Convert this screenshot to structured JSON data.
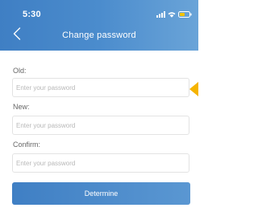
{
  "status_bar": {
    "time": "5:30",
    "icons": [
      "signal-icon",
      "wifi-icon",
      "battery-icon"
    ]
  },
  "nav": {
    "back_icon": "chevron-left-icon",
    "title": "Change password"
  },
  "form": {
    "old": {
      "label": "Old:",
      "placeholder": "Enter your password",
      "value": ""
    },
    "new": {
      "label": "New:",
      "placeholder": "Enter your password",
      "value": ""
    },
    "confirm": {
      "label": "Confirm:",
      "placeholder": "Enter your password",
      "value": ""
    },
    "submit_label": "Determine"
  },
  "colors": {
    "header_start": "#3f7fc4",
    "header_end": "#6aa4d8",
    "button": "#4a89c9",
    "hint_marker": "#f5b400"
  }
}
